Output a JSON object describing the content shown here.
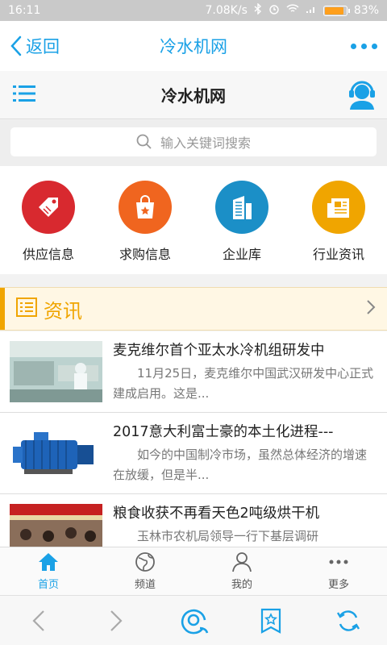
{
  "status_bar": {
    "time": "16:11",
    "network_speed": "7.08K/s",
    "battery_text": "83%",
    "battery_level": 0.83
  },
  "topbar": {
    "back_label": "返回",
    "title": "冷水机网"
  },
  "subheader": {
    "site_name": "冷水机网"
  },
  "search": {
    "placeholder": "输入关键词搜索"
  },
  "categories": [
    {
      "label": "供应信息",
      "color": "#d8292f",
      "icon": "tag-icon"
    },
    {
      "label": "求购信息",
      "color": "#f0651f",
      "icon": "shopping-bag-icon"
    },
    {
      "label": "企业库",
      "color": "#1b8fc7",
      "icon": "building-icon"
    },
    {
      "label": "行业资讯",
      "color": "#f0a500",
      "icon": "newspaper-icon"
    }
  ],
  "section": {
    "title": "资讯"
  },
  "news": [
    {
      "title": "麦克维尔首个亚太水冷机组研发中",
      "desc": "11月25日，麦克维尔中国武汉研发中心正式建成启用。这是..."
    },
    {
      "title": "2017意大利富士豪的本土化进程---",
      "desc": "如今的中国制冷市场，虽然总体经济的增速在放缓，但是半..."
    },
    {
      "title": "粮食收获不再看天色2吨级烘干机",
      "desc": "玉林市农机局领导一行下基层调研"
    }
  ],
  "tabs": [
    {
      "label": "首页",
      "icon": "home-icon"
    },
    {
      "label": "频道",
      "icon": "globe-icon"
    },
    {
      "label": "我的",
      "icon": "user-icon"
    },
    {
      "label": "更多",
      "icon": "more-dots-icon"
    }
  ],
  "colors": {
    "accent": "#1aa1e6",
    "section": "#f0a500"
  }
}
